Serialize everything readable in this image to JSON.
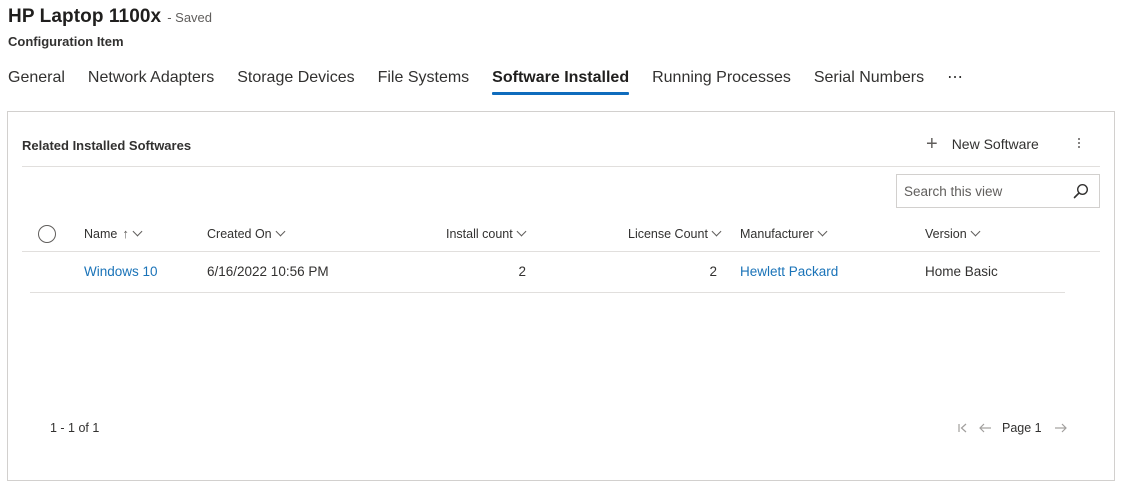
{
  "header": {
    "title": "HP Laptop 1100x",
    "saved": "- Saved",
    "subtitle": "Configuration Item"
  },
  "tabs": [
    {
      "label": "General",
      "active": false
    },
    {
      "label": "Network Adapters",
      "active": false
    },
    {
      "label": "Storage Devices",
      "active": false
    },
    {
      "label": "File Systems",
      "active": false
    },
    {
      "label": "Software Installed",
      "active": true
    },
    {
      "label": "Running Processes",
      "active": false
    },
    {
      "label": "Serial Numbers",
      "active": false
    },
    {
      "label": "⋯",
      "active": false
    }
  ],
  "section": {
    "title": "Related Installed Softwares",
    "new_button": "New Software",
    "more_icon": "kebab-vertical-icon"
  },
  "search": {
    "placeholder": "Search this view",
    "icon": "search-icon"
  },
  "grid": {
    "columns": [
      {
        "label": "Name",
        "sort": "ascending"
      },
      {
        "label": "Created On"
      },
      {
        "label": "Install count"
      },
      {
        "label": "License Count"
      },
      {
        "label": "Manufacturer"
      },
      {
        "label": "Version"
      }
    ],
    "rows": [
      {
        "name": "Windows 10",
        "created_on": "6/16/2022 10:56 PM",
        "install_count": "2",
        "license_count": "2",
        "manufacturer": "Hewlett Packard",
        "version": "Home Basic"
      }
    ]
  },
  "footer": {
    "count": "1 - 1 of 1",
    "page_label": "Page 1"
  },
  "colors": {
    "accent": "#0f6cbd",
    "link": "#1a73b8",
    "border": "#d2d0ce"
  }
}
